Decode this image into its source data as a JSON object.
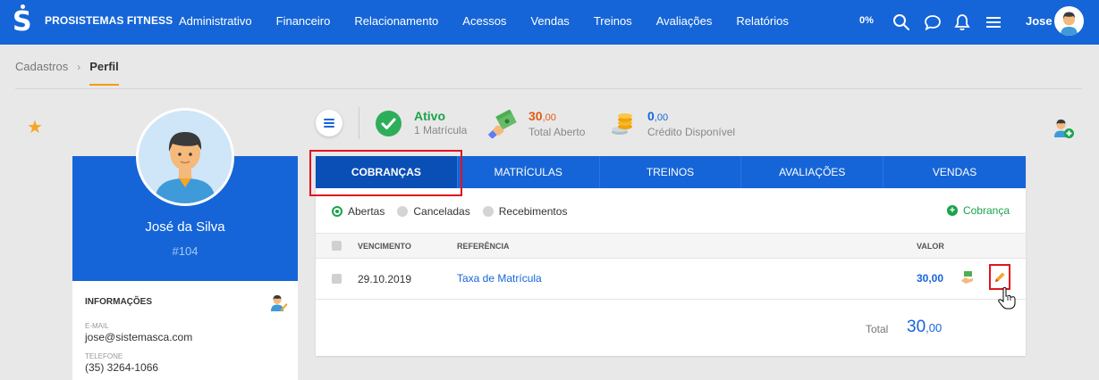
{
  "navbar": {
    "brand": "PROSISTEMAS FITNESS",
    "menu": [
      "Administrativo",
      "Financeiro",
      "Relacionamento",
      "Acessos",
      "Vendas",
      "Treinos",
      "Avaliações",
      "Relatórios"
    ],
    "percent": "0%",
    "icons": [
      "search-icon",
      "chat-icon",
      "bell-icon",
      "hamburger-icon"
    ],
    "user": "Jose"
  },
  "breadcrumb": {
    "root": "Cadastros",
    "current": "Perfil"
  },
  "profile": {
    "name": "José da Silva",
    "id": "#104",
    "info_title": "INFORMAÇÕES",
    "email_label": "E-MAIL",
    "email": "jose@sistemasca.com",
    "phone_label": "TELEFONE",
    "phone": "(35) 3264-1066"
  },
  "stats": {
    "status": "Ativo",
    "status_sub": "1 Matrícula",
    "open_int": "30",
    "open_dec": ",00",
    "open_sub": "Total Aberto",
    "credit_int": "0",
    "credit_dec": ",00",
    "credit_sub": "Crédito Disponível"
  },
  "tabs": [
    "COBRANÇAS",
    "MATRÍCULAS",
    "TREINOS",
    "AVALIAÇÕES",
    "VENDAS"
  ],
  "active_tab": 0,
  "filters": [
    "Abertas",
    "Canceladas",
    "Recebimentos"
  ],
  "add_charge": "Cobrança",
  "table": {
    "headers": {
      "due": "VENCIMENTO",
      "ref": "REFERÊNCIA",
      "value": "VALOR"
    },
    "rows": [
      {
        "due": "29.10.2019",
        "ref": "Taxa de Matrícula",
        "value": "30,00"
      }
    ]
  },
  "total": {
    "label": "Total",
    "int": "30",
    "dec": ",00"
  },
  "colors": {
    "primary": "#1565d8",
    "active_tab": "#0a4fb5",
    "success": "#1aa34a",
    "danger": "#e0141e",
    "accent": "#f39c12"
  }
}
